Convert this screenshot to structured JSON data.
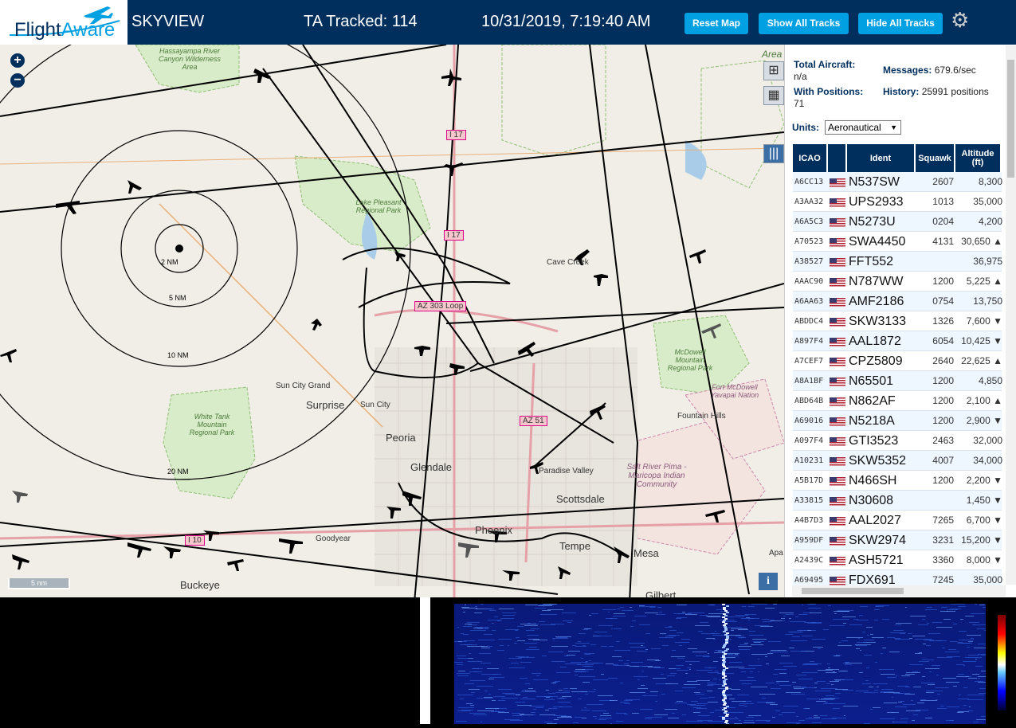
{
  "header": {
    "logo_text_1": "Flight",
    "logo_text_2": "Aware",
    "app_name": "SKYVIEW",
    "tracked_label": "TA Tracked: 114",
    "datetime": "10/31/2019, 7:19:40 AM",
    "reset_map": "Reset Map",
    "show_all_tracks": "Show All Tracks",
    "hide_all_tracks": "Hide All Tracks"
  },
  "map": {
    "zoom_in": "+",
    "zoom_out": "−",
    "scale_label": "5 nm",
    "info": "i",
    "range_labels": [
      "2 NM",
      "5 NM",
      "10 NM",
      "20 NM"
    ],
    "places": [
      "Hassayampa River Canyon Wilderness Area",
      "Lake Pleasant Regional Park",
      "Cave Creek",
      "Sun City Grand",
      "Surprise",
      "Sun City",
      "Peoria",
      "Glendale",
      "Paradise Valley",
      "Scottsdale",
      "Phoenix",
      "Tempe",
      "Goodyear",
      "Buckeye",
      "Mesa",
      "Gilbert",
      "White Tank Mountain Regional Park",
      "McDowell Mountain Regional Park",
      "Fort McDowell Yavapai Nation",
      "Fountain Hills",
      "Salt River Pima - Maricopa Indian Community",
      "Area",
      "Apa"
    ],
    "road_labels": [
      "I 17",
      "I 17",
      "AZ 303 Loop",
      "AZ 51",
      "I 10"
    ]
  },
  "panel": {
    "total_aircraft_label": "Total Aircraft:",
    "total_aircraft_value": "n/a",
    "with_positions_label": "With Positions:",
    "with_positions_value": "71",
    "messages_label": "Messages:",
    "messages_value": "679.6/sec",
    "history_label": "History:",
    "history_value": "25991 positions",
    "units_label": "Units:",
    "units_value": "Aeronautical",
    "columns": [
      "ICAO",
      "",
      "Ident",
      "Squawk",
      "Altitude (ft)"
    ],
    "rows": [
      {
        "icao": "A6CC13",
        "ident": "N537SW",
        "squawk": "2607",
        "alt": "8,300"
      },
      {
        "icao": "A3AA32",
        "ident": "UPS2933",
        "squawk": "1013",
        "alt": "35,000"
      },
      {
        "icao": "A6A5C3",
        "ident": "N5273U",
        "squawk": "0204",
        "alt": "4,200"
      },
      {
        "icao": "A70523",
        "ident": "SWA4450",
        "squawk": "4131",
        "alt": "30,650 ▲"
      },
      {
        "icao": "A38527",
        "ident": "FFT552",
        "squawk": "",
        "alt": "36,975"
      },
      {
        "icao": "AAAC90",
        "ident": "N787WW",
        "squawk": "1200",
        "alt": "5,225 ▲"
      },
      {
        "icao": "A6AA63",
        "ident": "AMF2186",
        "squawk": "0754",
        "alt": "13,750"
      },
      {
        "icao": "ABDDC4",
        "ident": "SKW3133",
        "squawk": "1326",
        "alt": "7,600 ▼"
      },
      {
        "icao": "A897F4",
        "ident": "AAL1872",
        "squawk": "6054",
        "alt": "10,425 ▼"
      },
      {
        "icao": "A7CEF7",
        "ident": "CPZ5809",
        "squawk": "2640",
        "alt": "22,625 ▲"
      },
      {
        "icao": "A8A1BF",
        "ident": "N65501",
        "squawk": "1200",
        "alt": "4,850"
      },
      {
        "icao": "ABD64B",
        "ident": "N862AF",
        "squawk": "1200",
        "alt": "2,100 ▲"
      },
      {
        "icao": "A69016",
        "ident": "N5218A",
        "squawk": "1200",
        "alt": "2,900 ▼"
      },
      {
        "icao": "A097F4",
        "ident": "GTI3523",
        "squawk": "2463",
        "alt": "32,000"
      },
      {
        "icao": "A10231",
        "ident": "SKW5352",
        "squawk": "4007",
        "alt": "34,000"
      },
      {
        "icao": "A5B17D",
        "ident": "N466SH",
        "squawk": "1200",
        "alt": "2,200 ▼"
      },
      {
        "icao": "A33815",
        "ident": "N30608",
        "squawk": "",
        "alt": "1,450 ▼"
      },
      {
        "icao": "A4B7D3",
        "ident": "AAL2027",
        "squawk": "7265",
        "alt": "6,700 ▼"
      },
      {
        "icao": "A959DF",
        "ident": "SKW2974",
        "squawk": "3231",
        "alt": "15,200 ▼"
      },
      {
        "icao": "A2439C",
        "ident": "ASH5721",
        "squawk": "3360",
        "alt": "8,000 ▼"
      },
      {
        "icao": "A69495",
        "ident": "FDX691",
        "squawk": "7245",
        "alt": "35,000"
      }
    ]
  },
  "colors": {
    "header_bg": "#002f5d",
    "accent": "#00a0e2",
    "map_bg": "#f1eee7"
  }
}
